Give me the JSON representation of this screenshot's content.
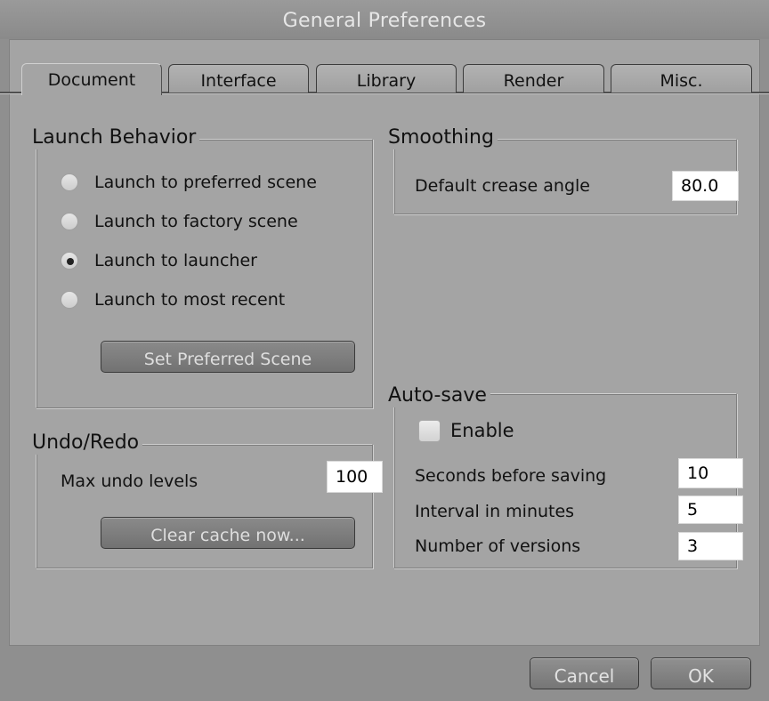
{
  "window": {
    "title": "General Preferences"
  },
  "tabs": [
    {
      "label": "Document",
      "active": true
    },
    {
      "label": "Interface",
      "active": false
    },
    {
      "label": "Library",
      "active": false
    },
    {
      "label": "Render",
      "active": false
    },
    {
      "label": "Misc.",
      "active": false
    }
  ],
  "launch_behavior": {
    "title": "Launch Behavior",
    "options": [
      {
        "label": "Launch to preferred scene",
        "selected": false
      },
      {
        "label": "Launch to factory scene",
        "selected": false
      },
      {
        "label": "Launch to launcher",
        "selected": true
      },
      {
        "label": "Launch to most recent",
        "selected": false
      }
    ],
    "set_preferred_button": "Set Preferred Scene"
  },
  "undo_redo": {
    "title": "Undo/Redo",
    "max_undo_label": "Max undo levels",
    "max_undo_value": "100",
    "clear_cache_button": "Clear cache now..."
  },
  "smoothing": {
    "title": "Smoothing",
    "crease_label": "Default crease angle",
    "crease_value": "80.0"
  },
  "auto_save": {
    "title": "Auto-save",
    "enable_label": "Enable",
    "enabled": false,
    "seconds_label": "Seconds before saving",
    "seconds_value": "10",
    "interval_label": "Interval in minutes",
    "interval_value": "5",
    "versions_label": "Number of versions",
    "versions_value": "3"
  },
  "footer": {
    "cancel_label": "Cancel",
    "ok_label": "OK"
  }
}
